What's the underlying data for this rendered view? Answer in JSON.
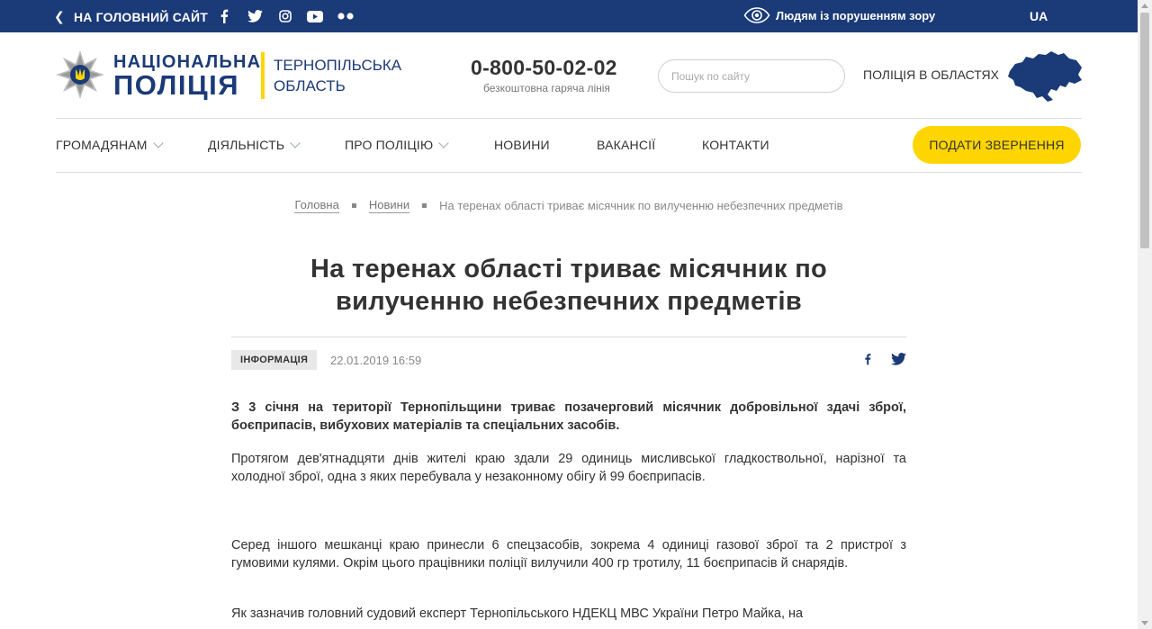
{
  "topbar": {
    "back_label": "НА ГОЛОВНИЙ САЙТ",
    "social_icons": [
      "facebook-icon",
      "twitter-icon",
      "instagram-icon",
      "youtube-icon",
      "flickr-icon"
    ],
    "accessibility_label": "Людям із порушенням зору",
    "language": "UA"
  },
  "header": {
    "brand_line1": "НАЦІОНАЛЬНА",
    "brand_line2": "ПОЛІЦІЯ",
    "region_line1": "ТЕРНОПІЛЬСЬКА",
    "region_line2": "ОБЛАСТЬ",
    "phone": "0-800-50-02-02",
    "phone_caption": "безкоштовна гаряча лінія",
    "search_placeholder": "Пошук по сайту",
    "regions_link": "ПОЛІЦІЯ В ОБЛАСТЯХ"
  },
  "nav": {
    "items": [
      {
        "label": "ГРОМАДЯНАМ",
        "has_dropdown": true
      },
      {
        "label": "ДІЯЛЬНІСТЬ",
        "has_dropdown": true
      },
      {
        "label": "ПРО ПОЛІЦІЮ",
        "has_dropdown": true
      },
      {
        "label": "НОВИНИ",
        "has_dropdown": false
      },
      {
        "label": "ВАКАНСІЇ",
        "has_dropdown": false
      },
      {
        "label": "КОНТАКТИ",
        "has_dropdown": false
      }
    ],
    "cta_label": "ПОДАТИ ЗВЕРНЕННЯ"
  },
  "breadcrumb": {
    "home": "Головна",
    "news": "Новини",
    "current": "На теренах області триває місячник по вилученню небезпечних предметів"
  },
  "article": {
    "title_line1": "На теренах області триває місячник по",
    "title_line2": "вилученню небезпечних предметів",
    "category": "ІНФОРМАЦІЯ",
    "date": "22.01.2019 16:59",
    "paragraphs": [
      "З 3 січня на території Тернопільщини триває позачерговий місячник добровільної здачі зброї, боєприпасів, вибухових матеріалів та спеціальних засобів.",
      "Протягом дев'ятнадцяти днів жителі краю здали 29 одиниць мисливської гладкоствольної, нарізної та холодної зброї, одна з яких перебувала у незаконному обігу й 99 боєприпасів.",
      "Серед іншого мешканці краю принесли 6 спецзасобів, зокрема 4 одиниці газової зброї та 2 пристрої з гумовими кулями. Окрім цього працівники поліції вилучили 400 гр тротилу, 11 боєприпасів й снарядів.",
      "Як зазначив головний судовий експерт Тернопільського НДЕКЦ МВС України Петро Майка, на"
    ]
  },
  "colors": {
    "brand_blue": "#1b3a78",
    "accent_yellow": "#ffd500"
  }
}
